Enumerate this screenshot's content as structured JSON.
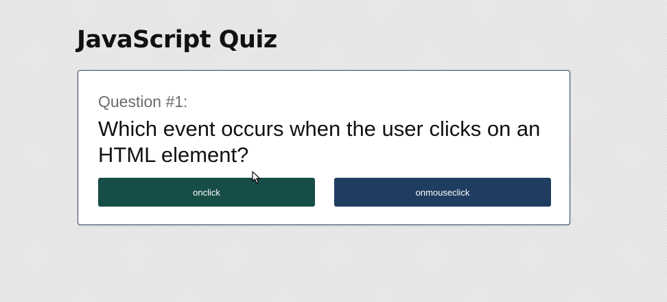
{
  "quiz": {
    "title": "JavaScript Quiz",
    "question_number": "Question #1:",
    "question_text": "Which event occurs when the user clicks on an HTML element?",
    "answers": [
      {
        "label": "onclick",
        "color": "#174d47"
      },
      {
        "label": "onmouseclick",
        "color": "#1f3d61"
      }
    ]
  },
  "colors": {
    "card_border": "#34495e",
    "background": "#ececec"
  },
  "icons": {
    "cursor": "mouse-pointer-icon"
  }
}
